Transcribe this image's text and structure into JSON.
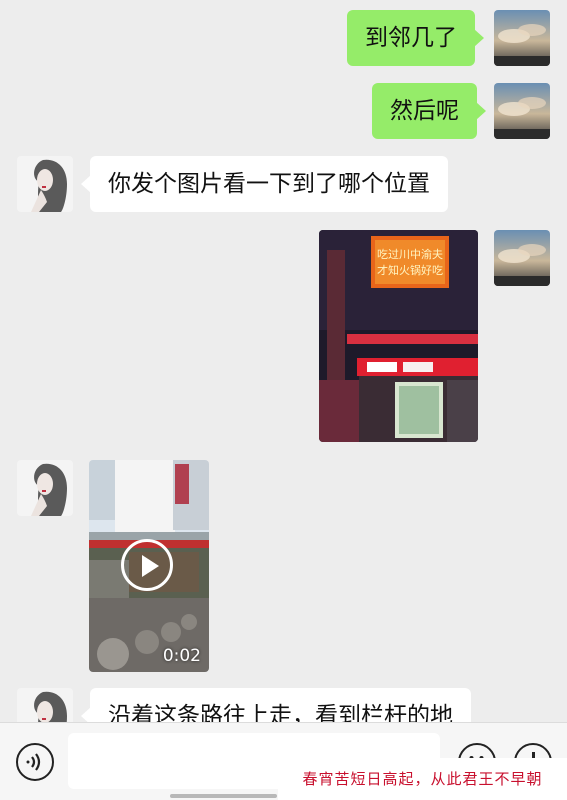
{
  "messages": [
    {
      "side": "right",
      "type": "text",
      "text": "到邻几了"
    },
    {
      "side": "right",
      "type": "text",
      "text": "然后呢"
    },
    {
      "side": "left",
      "type": "text",
      "text": "你发个图片看一下到了哪个位置"
    },
    {
      "side": "right",
      "type": "image",
      "image_icon": "storefront-photo"
    },
    {
      "side": "left",
      "type": "video",
      "duration": "0:02",
      "image_icon": "street-video-thumbnail"
    },
    {
      "side": "left",
      "type": "text",
      "text": "沿着这条路往上走，看到栏杆的地"
    }
  ],
  "photo_signage": {
    "line1": "吃过川中渝夫",
    "line2": "才知火锅好吃"
  },
  "input_bar": {
    "voice_icon": "voice-icon",
    "emoji_icon": "emoji-icon",
    "plus_icon": "plus-icon",
    "input_value": ""
  },
  "watermark": "春宵苦短日高起，从此君王不早朝",
  "colors": {
    "outgoing_bubble": "#95ec69",
    "incoming_bubble": "#ffffff",
    "background": "#ededed",
    "watermark": "#c8102e"
  }
}
